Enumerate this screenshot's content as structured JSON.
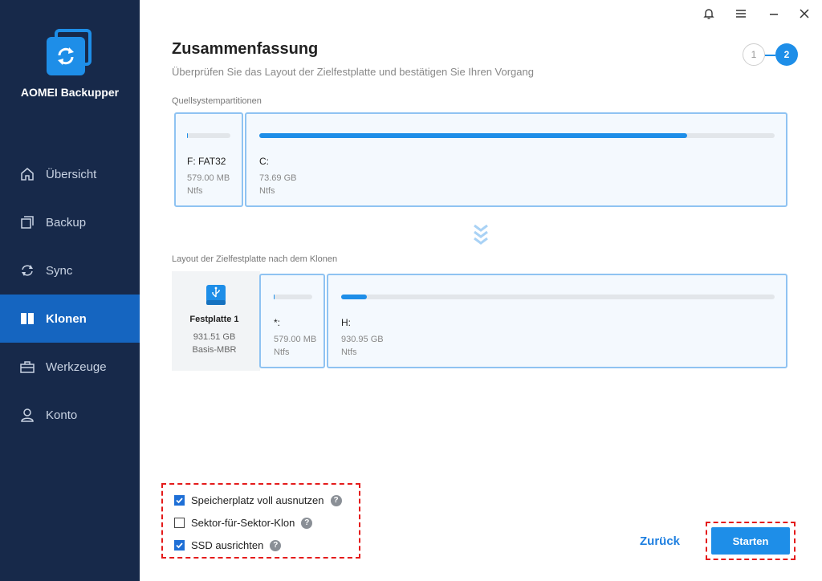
{
  "app": {
    "name": "AOMEI Backupper"
  },
  "sidebar": {
    "items": [
      {
        "label": "Übersicht",
        "icon": "home-icon"
      },
      {
        "label": "Backup",
        "icon": "backup-icon"
      },
      {
        "label": "Sync",
        "icon": "sync-icon"
      },
      {
        "label": "Klonen",
        "icon": "clone-icon",
        "active": true
      },
      {
        "label": "Werkzeuge",
        "icon": "tools-icon"
      },
      {
        "label": "Konto",
        "icon": "user-icon"
      }
    ]
  },
  "header": {
    "title": "Zusammenfassung",
    "subtitle": "Überprüfen Sie das Layout der Zielfestplatte und bestätigen Sie Ihren Vorgang",
    "steps": [
      "1",
      "2"
    ],
    "current_step": 2
  },
  "source": {
    "label": "Quellsystempartitionen",
    "partitions": [
      {
        "name": "F: FAT32",
        "size": "579.00 MB",
        "fs": "Ntfs",
        "used_fraction": 0.02
      },
      {
        "name": "C:",
        "size": "73.69 GB",
        "fs": "Ntfs",
        "used_fraction": 0.83
      }
    ]
  },
  "target": {
    "label": "Layout der Zielfestplatte nach dem Klonen",
    "disk": {
      "name": "Festplatte 1",
      "size": "931.51 GB",
      "type": "Basis-MBR"
    },
    "partitions": [
      {
        "name": "*:",
        "size": "579.00 MB",
        "fs": "Ntfs",
        "used_fraction": 0.02
      },
      {
        "name": "H:",
        "size": "930.95 GB",
        "fs": "Ntfs",
        "used_fraction": 0.06
      }
    ]
  },
  "options": {
    "items": [
      {
        "label": "Speicherplatz voll ausnutzen",
        "checked": true
      },
      {
        "label": "Sektor-für-Sektor-Klon",
        "checked": false
      },
      {
        "label": "SSD ausrichten",
        "checked": true
      }
    ],
    "help_glyph": "?"
  },
  "footer": {
    "back_label": "Zurück",
    "start_label": "Starten"
  },
  "colors": {
    "accent": "#1e8ee8",
    "sidebar": "#17294a",
    "active": "#1565c0",
    "highlight": "#e41b1b"
  }
}
